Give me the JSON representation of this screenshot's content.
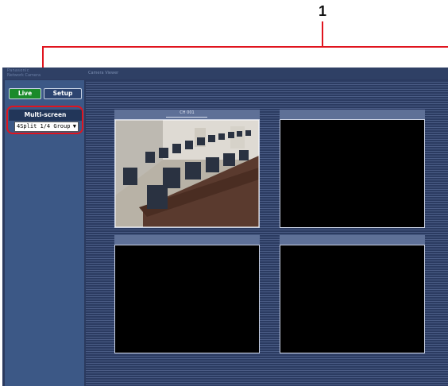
{
  "callout": {
    "number": "1"
  },
  "window": {
    "title_line_1": "Panasonic",
    "title_line_2": "Network Camera",
    "title_right": "Camera Viewer"
  },
  "sidebar": {
    "live_button": "Live",
    "setup_button": "Setup",
    "multiscreen_header": "Multi-screen",
    "group_select": {
      "value": "4Split 1/4 Group"
    }
  },
  "cameras": [
    {
      "label": "CH 001",
      "status": "live"
    },
    {
      "label": "",
      "status": "no-signal"
    },
    {
      "label": "",
      "status": "no-signal"
    },
    {
      "label": "",
      "status": "no-signal"
    }
  ],
  "colors": {
    "accent_live": "#1a8a2a",
    "callout_red": "#e0141e",
    "panel_bg": "#3c5886",
    "main_bg": "#2b3a5e"
  }
}
